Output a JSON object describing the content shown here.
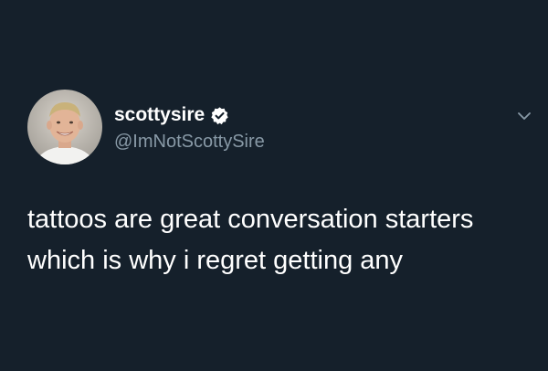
{
  "colors": {
    "background": "#15202b",
    "primary_text": "#ffffff",
    "secondary_text": "#8899a6",
    "verified_badge": "#ffffff"
  },
  "author": {
    "display_name": "scottysire",
    "handle": "@ImNotScottySire",
    "verified": true,
    "avatar_icon": "profile-photo"
  },
  "menu": {
    "icon": "chevron-down-icon"
  },
  "tweet": {
    "lines": [
      "tattoos are great conversation starters",
      "which is why i regret getting any"
    ]
  }
}
